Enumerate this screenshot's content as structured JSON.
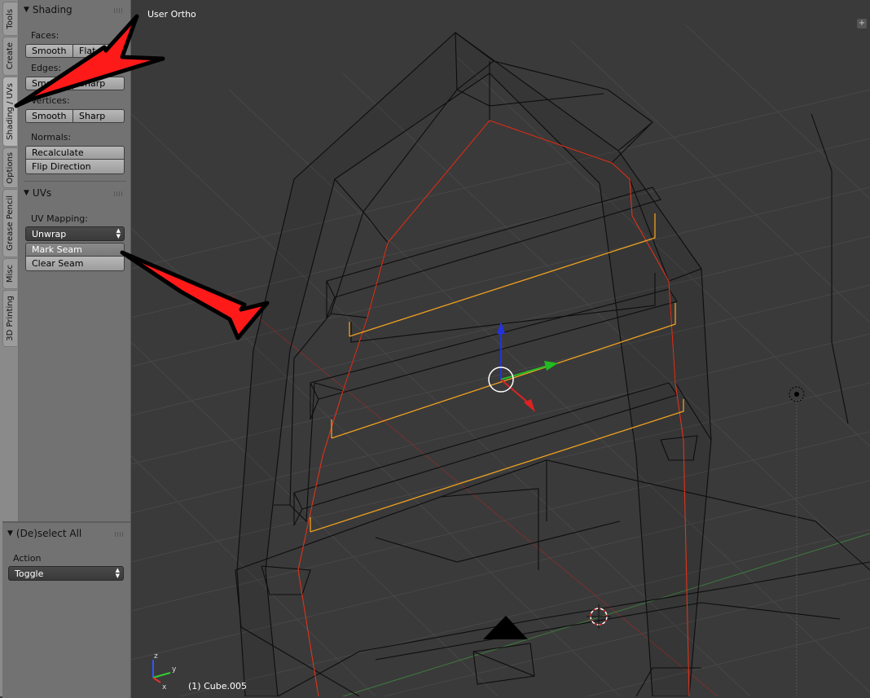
{
  "tabs": [
    "Tools",
    "Create",
    "Shading / UVs",
    "Options",
    "Grease Pencil",
    "Misc",
    "3D Printing"
  ],
  "shading_panel": {
    "title": "Shading",
    "faces_label": "Faces:",
    "faces_smooth": "Smooth",
    "faces_flat": "Flat",
    "edges_label": "Edges:",
    "edges_smooth": "Smooth",
    "edges_sharp": "Sharp",
    "vertices_label": "Vertices:",
    "vertices_smooth": "Smooth",
    "vertices_sharp": "Sharp",
    "normals_label": "Normals:",
    "recalculate": "Recalculate",
    "flip_direction": "Flip Direction"
  },
  "uvs_panel": {
    "title": "UVs",
    "mapping_label": "UV Mapping:",
    "mapping_value": "Unwrap",
    "mark_seam": "Mark Seam",
    "clear_seam": "Clear Seam"
  },
  "operator_panel": {
    "title": "(De)select All",
    "action_label": "Action",
    "action_value": "Toggle"
  },
  "viewport": {
    "view_name": "User Ortho",
    "object_info": "(1) Cube.005"
  },
  "colors": {
    "seam": "#e0321a",
    "selected_edge": "#f0a020",
    "arrow_fill": "#ff1a1a",
    "panel_bg": "#727272",
    "viewport_bg": "#3a3a3a"
  },
  "icons": [
    "collapse-triangle-icon",
    "drag-grip-icon",
    "dropdown-arrows-icon",
    "transform-manipulator-icon",
    "3d-cursor-icon",
    "lamp-icon",
    "camera-icon",
    "axis-gizmo-icon",
    "red-arrow-annotation"
  ]
}
